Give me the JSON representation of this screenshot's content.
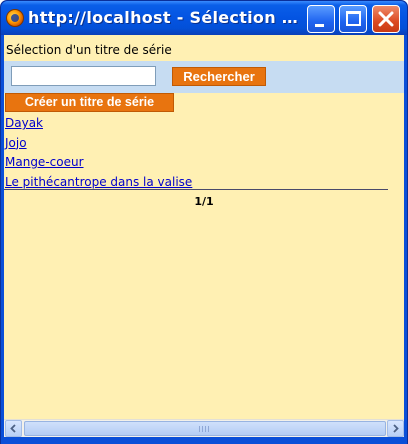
{
  "window": {
    "title": "http://localhost - Sélection d'un titre de série - Mozilla Firefox"
  },
  "header": {
    "text": "Sélection d'un titre de série"
  },
  "search": {
    "value": "",
    "button_label": "Rechercher"
  },
  "actions": {
    "create_label": "Créer un titre de série"
  },
  "results": [
    {
      "label": "Dayak"
    },
    {
      "label": "Jojo"
    },
    {
      "label": "Mange-coeur"
    },
    {
      "label": "Le pithécantrope dans la valise"
    }
  ],
  "pagination": {
    "text": "1/1"
  },
  "colors": {
    "content_bg": "#fff0b3",
    "search_band_bg": "#c6dcf2",
    "button_orange": "#e8740f",
    "link": "#0000cc",
    "titlebar_blue": "#0454e2"
  },
  "icons": {
    "app": "firefox-icon",
    "minimize": "minimize-icon",
    "maximize": "maximize-icon",
    "close": "close-icon",
    "scroll_left": "arrow-left-icon",
    "scroll_right": "arrow-right-icon"
  }
}
